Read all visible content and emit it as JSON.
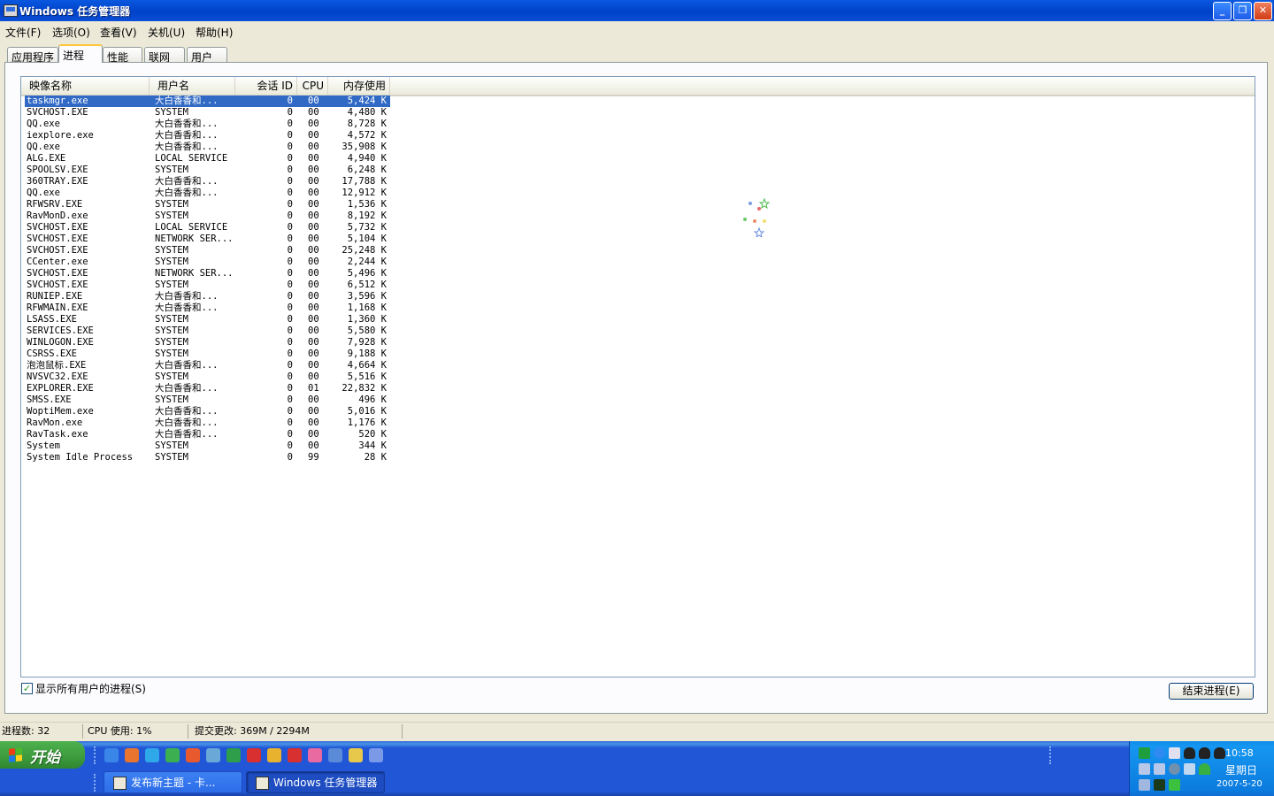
{
  "window": {
    "title": "Windows 任务管理器",
    "buttons": {
      "minimize": "_",
      "maximize": "❐",
      "close": "✕"
    }
  },
  "menu": {
    "items": [
      "文件(F)",
      "选项(O)",
      "查看(V)",
      "关机(U)",
      "帮助(H)"
    ]
  },
  "tabs": [
    "应用程序",
    "进程",
    "性能",
    "联网",
    "用户"
  ],
  "active_tab": "进程",
  "columns": {
    "name": "映像名称",
    "user": "用户名",
    "session": "会话 ID",
    "cpu": "CPU",
    "memory": "内存使用"
  },
  "processes": [
    {
      "name": "taskmgr.exe",
      "user": "大白香香和...",
      "session": "0",
      "cpu": "00",
      "mem": "5,424 K"
    },
    {
      "name": "SVCHOST.EXE",
      "user": "SYSTEM",
      "session": "0",
      "cpu": "00",
      "mem": "4,480 K"
    },
    {
      "name": "QQ.exe",
      "user": "大白香香和...",
      "session": "0",
      "cpu": "00",
      "mem": "8,728 K"
    },
    {
      "name": "iexplore.exe",
      "user": "大白香香和...",
      "session": "0",
      "cpu": "00",
      "mem": "4,572 K"
    },
    {
      "name": "QQ.exe",
      "user": "大白香香和...",
      "session": "0",
      "cpu": "00",
      "mem": "35,908 K"
    },
    {
      "name": "ALG.EXE",
      "user": "LOCAL SERVICE",
      "session": "0",
      "cpu": "00",
      "mem": "4,940 K"
    },
    {
      "name": "SPOOLSV.EXE",
      "user": "SYSTEM",
      "session": "0",
      "cpu": "00",
      "mem": "6,248 K"
    },
    {
      "name": "360TRAY.EXE",
      "user": "大白香香和...",
      "session": "0",
      "cpu": "00",
      "mem": "17,788 K"
    },
    {
      "name": "QQ.exe",
      "user": "大白香香和...",
      "session": "0",
      "cpu": "00",
      "mem": "12,912 K"
    },
    {
      "name": "RFWSRV.EXE",
      "user": "SYSTEM",
      "session": "0",
      "cpu": "00",
      "mem": "1,536 K"
    },
    {
      "name": "RavMonD.exe",
      "user": "SYSTEM",
      "session": "0",
      "cpu": "00",
      "mem": "8,192 K"
    },
    {
      "name": "SVCHOST.EXE",
      "user": "LOCAL SERVICE",
      "session": "0",
      "cpu": "00",
      "mem": "5,732 K"
    },
    {
      "name": "SVCHOST.EXE",
      "user": "NETWORK SER...",
      "session": "0",
      "cpu": "00",
      "mem": "5,104 K"
    },
    {
      "name": "SVCHOST.EXE",
      "user": "SYSTEM",
      "session": "0",
      "cpu": "00",
      "mem": "25,248 K"
    },
    {
      "name": "CCenter.exe",
      "user": "SYSTEM",
      "session": "0",
      "cpu": "00",
      "mem": "2,244 K"
    },
    {
      "name": "SVCHOST.EXE",
      "user": "NETWORK SER...",
      "session": "0",
      "cpu": "00",
      "mem": "5,496 K"
    },
    {
      "name": "SVCHOST.EXE",
      "user": "SYSTEM",
      "session": "0",
      "cpu": "00",
      "mem": "6,512 K"
    },
    {
      "name": "RUNIEP.EXE",
      "user": "大白香香和...",
      "session": "0",
      "cpu": "00",
      "mem": "3,596 K"
    },
    {
      "name": "RFWMAIN.EXE",
      "user": "大白香香和...",
      "session": "0",
      "cpu": "00",
      "mem": "1,168 K"
    },
    {
      "name": "LSASS.EXE",
      "user": "SYSTEM",
      "session": "0",
      "cpu": "00",
      "mem": "1,360 K"
    },
    {
      "name": "SERVICES.EXE",
      "user": "SYSTEM",
      "session": "0",
      "cpu": "00",
      "mem": "5,580 K"
    },
    {
      "name": "WINLOGON.EXE",
      "user": "SYSTEM",
      "session": "0",
      "cpu": "00",
      "mem": "7,928 K"
    },
    {
      "name": "CSRSS.EXE",
      "user": "SYSTEM",
      "session": "0",
      "cpu": "00",
      "mem": "9,188 K"
    },
    {
      "name": "泡泡鼠标.EXE",
      "user": "大白香香和...",
      "session": "0",
      "cpu": "00",
      "mem": "4,664 K"
    },
    {
      "name": "NVSVC32.EXE",
      "user": "SYSTEM",
      "session": "0",
      "cpu": "00",
      "mem": "5,516 K"
    },
    {
      "name": "EXPLORER.EXE",
      "user": "大白香香和...",
      "session": "0",
      "cpu": "01",
      "mem": "22,832 K"
    },
    {
      "name": "SMSS.EXE",
      "user": "SYSTEM",
      "session": "0",
      "cpu": "00",
      "mem": "496 K"
    },
    {
      "name": "WoptiMem.exe",
      "user": "大白香香和...",
      "session": "0",
      "cpu": "00",
      "mem": "5,016 K"
    },
    {
      "name": "RavMon.exe",
      "user": "大白香香和...",
      "session": "0",
      "cpu": "00",
      "mem": "1,176 K"
    },
    {
      "name": "RavTask.exe",
      "user": "大白香香和...",
      "session": "0",
      "cpu": "00",
      "mem": "520 K"
    },
    {
      "name": "System",
      "user": "SYSTEM",
      "session": "0",
      "cpu": "00",
      "mem": "344 K"
    },
    {
      "name": "System Idle Process",
      "user": "SYSTEM",
      "session": "0",
      "cpu": "99",
      "mem": "28 K"
    }
  ],
  "selected_row": 0,
  "show_all_users": {
    "label": "显示所有用户的进程(S)",
    "checked": true,
    "check_glyph": "✓"
  },
  "end_process_button": "结束进程(E)",
  "status": {
    "processes": "进程数: 32",
    "cpu": "CPU 使用: 1%",
    "commit": "提交更改: 369M / 2294M"
  },
  "taskbar": {
    "start_label": "开始",
    "quick_launch_icons": [
      "ie-icon",
      "download-icon",
      "arrow-icon",
      "shield-icon",
      "antivirus-icon",
      "network-icon",
      "globe-icon",
      "security-icon",
      "qq-user-icon",
      "qq-icon",
      "app-icon",
      "disk-icon",
      "battery-icon",
      "moon-icon"
    ],
    "buttons": [
      {
        "label": "发布新主题 - 卡...",
        "active": false
      },
      {
        "label": "Windows 任务管理器",
        "active": true
      }
    ]
  },
  "tray": {
    "time": "10:58",
    "day": "星期日",
    "date": "2007-5-20"
  },
  "colors": {
    "titlebar": "#0A58E0",
    "selection": "#316AC5",
    "taskbar": "#2157D7",
    "start": "#3C9A3D",
    "tab_highlight": "#FFC83C"
  }
}
